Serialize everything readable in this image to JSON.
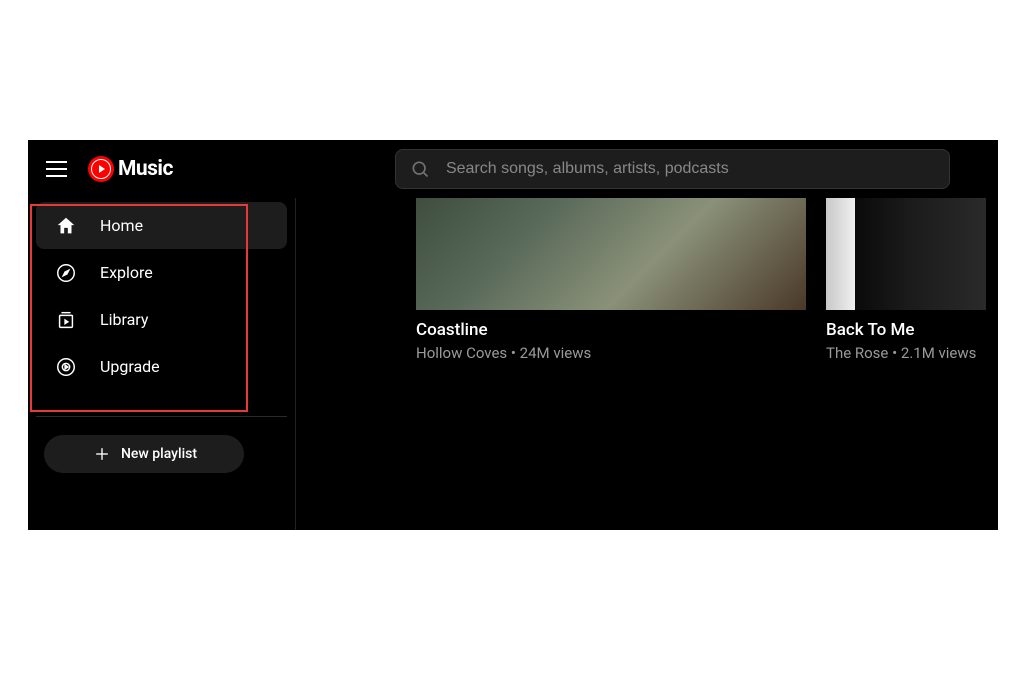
{
  "header": {
    "logo_text": "Music",
    "search_placeholder": "Search songs, albums, artists, podcasts"
  },
  "sidebar": {
    "items": [
      {
        "label": "Home",
        "icon": "home",
        "active": true
      },
      {
        "label": "Explore",
        "icon": "explore",
        "active": false
      },
      {
        "label": "Library",
        "icon": "library",
        "active": false
      },
      {
        "label": "Upgrade",
        "icon": "upgrade",
        "active": false
      }
    ],
    "new_playlist_label": "New playlist"
  },
  "tracks": [
    {
      "title": "Coastline",
      "meta": "Hollow Coves • 24M views"
    },
    {
      "title": "Back To Me",
      "meta": "The Rose • 2.1M views"
    }
  ]
}
